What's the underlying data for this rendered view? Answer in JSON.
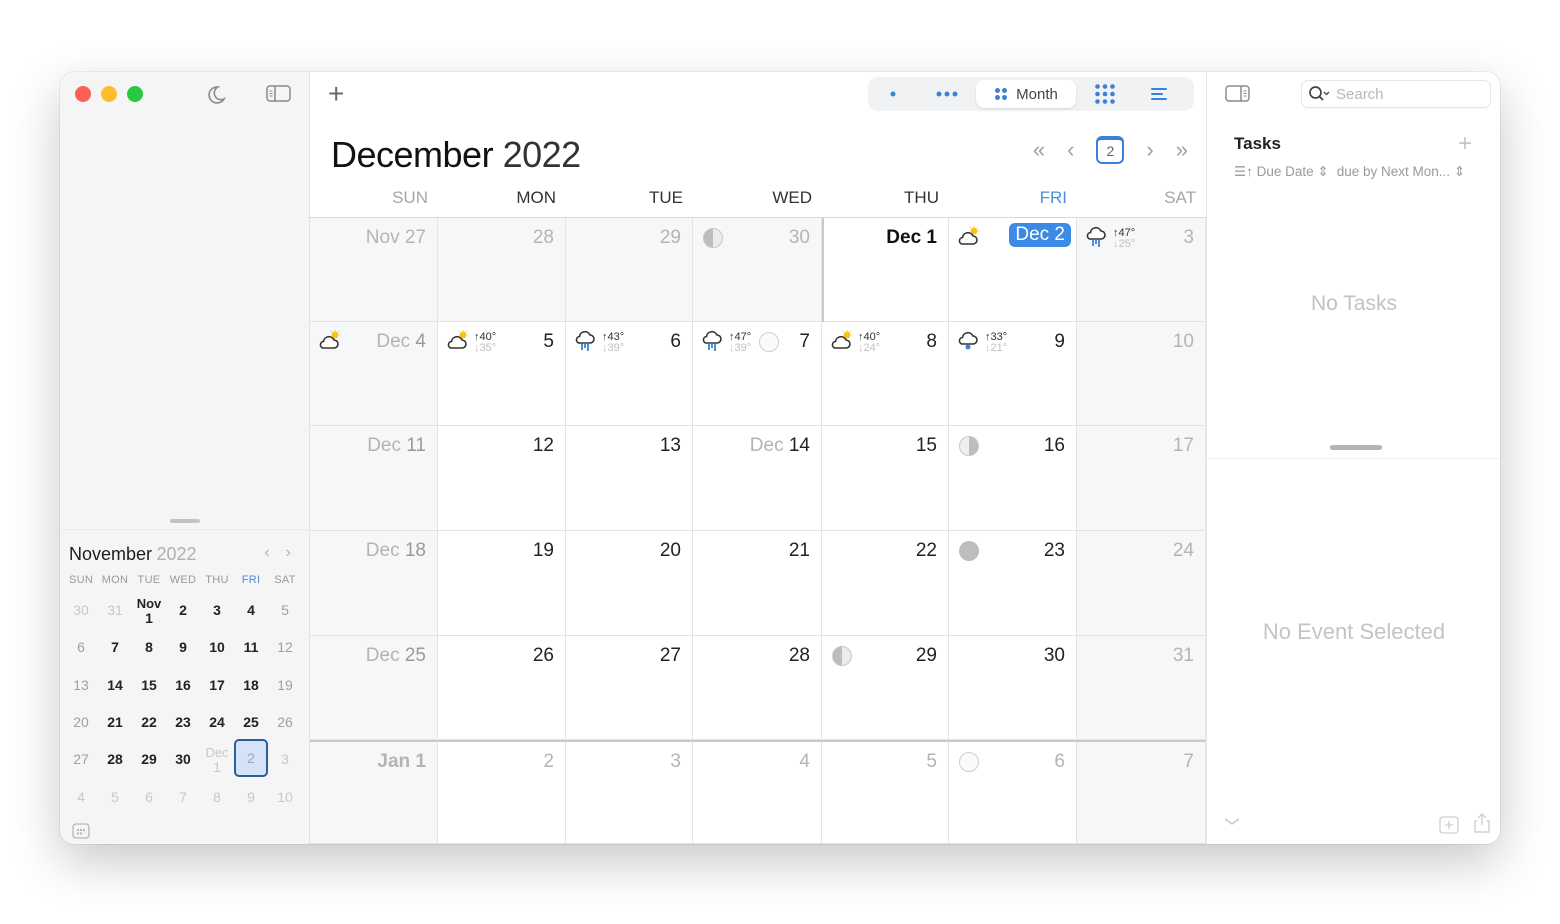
{
  "app": {
    "window_controls": [
      "close",
      "minimize",
      "zoom"
    ],
    "sidebar_icons": [
      "moon-icon",
      "sidebar-toggle-icon"
    ]
  },
  "toolbar": {
    "add_label": "+",
    "views": [
      {
        "id": "day",
        "icon": "single-dot-icon",
        "label": ""
      },
      {
        "id": "week",
        "icon": "three-dots-icon",
        "label": ""
      },
      {
        "id": "month",
        "icon": "four-dots-icon",
        "label": "Month",
        "active": true
      },
      {
        "id": "year",
        "icon": "grid-dots-icon",
        "label": ""
      },
      {
        "id": "list",
        "icon": "list-icon",
        "label": ""
      }
    ]
  },
  "main": {
    "month_name": "December",
    "year": "2022",
    "nav": {
      "prev_fast": "«",
      "prev": "‹",
      "today": "2",
      "next": "›",
      "next_fast": "»"
    },
    "weekdays": [
      "SUN",
      "MON",
      "TUE",
      "WED",
      "THU",
      "FRI",
      "SAT"
    ],
    "accent_color": "#3b8ae6",
    "weeks": [
      [
        {
          "prefix": "Nov",
          "day": "27",
          "kind": "prev"
        },
        {
          "day": "28",
          "kind": "prev"
        },
        {
          "day": "29",
          "kind": "prev"
        },
        {
          "day": "30",
          "kind": "prev",
          "moon": "first-quarter"
        },
        {
          "prefix": "Dec",
          "day": "1",
          "kind": "bold"
        },
        {
          "prefix": "Dec",
          "day": "2",
          "kind": "today",
          "weather": {
            "icon": "partly-cloudy-icon"
          }
        },
        {
          "day": "3",
          "kind": "weekend",
          "weather": {
            "icon": "rain-icon",
            "hi": "↑47°",
            "lo": "↓25°"
          }
        }
      ],
      [
        {
          "prefix": "Dec",
          "day": "4",
          "kind": "weekend",
          "weather": {
            "icon": "partly-cloudy-icon"
          }
        },
        {
          "day": "5",
          "kind": "normal",
          "weather": {
            "icon": "partly-cloudy-icon",
            "hi": "↑40°",
            "lo": "↓35°"
          }
        },
        {
          "day": "6",
          "kind": "normal",
          "weather": {
            "icon": "rain-icon",
            "hi": "↑43°",
            "lo": "↓39°"
          }
        },
        {
          "day": "7",
          "kind": "normal",
          "weather": {
            "icon": "rain-icon",
            "hi": "↑47°",
            "lo": "↓39°"
          },
          "moon_inline": "full"
        },
        {
          "day": "8",
          "kind": "normal",
          "weather": {
            "icon": "partly-cloudy-icon",
            "hi": "↑40°",
            "lo": "↓24°"
          }
        },
        {
          "day": "9",
          "kind": "normal",
          "weather": {
            "icon": "snow-icon",
            "hi": "↑33°",
            "lo": "↓21°"
          }
        },
        {
          "day": "10",
          "kind": "weekend"
        }
      ],
      [
        {
          "prefix": "Dec",
          "day": "11",
          "kind": "weekend"
        },
        {
          "day": "12",
          "kind": "normal"
        },
        {
          "day": "13",
          "kind": "normal"
        },
        {
          "prefix": "Dec",
          "day": "14",
          "kind": "normal"
        },
        {
          "day": "15",
          "kind": "normal"
        },
        {
          "day": "16",
          "kind": "normal",
          "moon": "last-quarter"
        },
        {
          "day": "17",
          "kind": "weekend"
        }
      ],
      [
        {
          "prefix": "Dec",
          "day": "18",
          "kind": "weekend"
        },
        {
          "day": "19",
          "kind": "normal"
        },
        {
          "day": "20",
          "kind": "normal"
        },
        {
          "day": "21",
          "kind": "normal"
        },
        {
          "day": "22",
          "kind": "normal"
        },
        {
          "day": "23",
          "kind": "normal",
          "moon": "new"
        },
        {
          "day": "24",
          "kind": "weekend"
        }
      ],
      [
        {
          "prefix": "Dec",
          "day": "25",
          "kind": "weekend"
        },
        {
          "day": "26",
          "kind": "normal"
        },
        {
          "day": "27",
          "kind": "normal"
        },
        {
          "day": "28",
          "kind": "normal"
        },
        {
          "day": "29",
          "kind": "normal",
          "moon": "first-quarter"
        },
        {
          "day": "30",
          "kind": "normal"
        },
        {
          "day": "31",
          "kind": "weekend"
        }
      ],
      [
        {
          "prefix": "Jan",
          "day": "1",
          "kind": "next-jan"
        },
        {
          "day": "2",
          "kind": "next"
        },
        {
          "day": "3",
          "kind": "next"
        },
        {
          "day": "4",
          "kind": "next"
        },
        {
          "day": "5",
          "kind": "next"
        },
        {
          "day": "6",
          "kind": "next",
          "moon": "full"
        },
        {
          "day": "7",
          "kind": "next-weekend"
        }
      ]
    ]
  },
  "mini_calendar": {
    "month": "November",
    "year": "2022",
    "prev": "‹",
    "next": "›",
    "weekdays": [
      "SUN",
      "MON",
      "TUE",
      "WED",
      "THU",
      "FRI",
      "SAT"
    ],
    "days": [
      {
        "d": "30",
        "k": "other"
      },
      {
        "d": "31",
        "k": "other"
      },
      {
        "m": "Nov",
        "d": "1",
        "k": "n"
      },
      {
        "d": "2",
        "k": "n"
      },
      {
        "d": "3",
        "k": "n"
      },
      {
        "d": "4",
        "k": "n"
      },
      {
        "d": "5",
        "k": "weekend"
      },
      {
        "d": "6",
        "k": "weekend"
      },
      {
        "d": "7",
        "k": "n"
      },
      {
        "d": "8",
        "k": "n"
      },
      {
        "d": "9",
        "k": "n"
      },
      {
        "d": "10",
        "k": "n"
      },
      {
        "d": "11",
        "k": "n"
      },
      {
        "d": "12",
        "k": "weekend"
      },
      {
        "d": "13",
        "k": "weekend"
      },
      {
        "d": "14",
        "k": "n"
      },
      {
        "d": "15",
        "k": "n"
      },
      {
        "d": "16",
        "k": "n"
      },
      {
        "d": "17",
        "k": "n"
      },
      {
        "d": "18",
        "k": "n"
      },
      {
        "d": "19",
        "k": "weekend"
      },
      {
        "d": "20",
        "k": "weekend"
      },
      {
        "d": "21",
        "k": "n"
      },
      {
        "d": "22",
        "k": "n"
      },
      {
        "d": "23",
        "k": "n"
      },
      {
        "d": "24",
        "k": "n"
      },
      {
        "d": "25",
        "k": "n"
      },
      {
        "d": "26",
        "k": "weekend"
      },
      {
        "d": "27",
        "k": "weekend"
      },
      {
        "d": "28",
        "k": "n"
      },
      {
        "d": "29",
        "k": "n"
      },
      {
        "d": "30",
        "k": "n"
      },
      {
        "m": "Dec",
        "d": "1",
        "k": "other"
      },
      {
        "d": "2",
        "k": "sel"
      },
      {
        "d": "3",
        "k": "other"
      },
      {
        "d": "4",
        "k": "other"
      },
      {
        "d": "5",
        "k": "other"
      },
      {
        "d": "6",
        "k": "other"
      },
      {
        "d": "7",
        "k": "other"
      },
      {
        "d": "8",
        "k": "other"
      },
      {
        "d": "9",
        "k": "other"
      },
      {
        "d": "10",
        "k": "other"
      }
    ]
  },
  "right_panel": {
    "search_placeholder": "Search",
    "tasks_title": "Tasks",
    "add_task": "+",
    "sort_label": "Due Date",
    "filter_label": "due by Next Mon...",
    "no_tasks": "No Tasks",
    "no_event": "No Event Selected"
  }
}
